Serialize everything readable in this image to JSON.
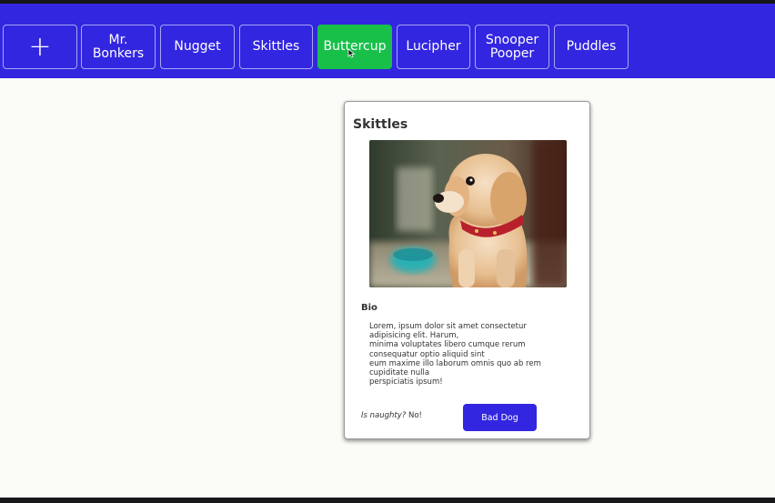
{
  "navbar": {
    "add_label": "+",
    "pets": [
      {
        "name": "Mr.\nBonkers",
        "active": false
      },
      {
        "name": "Nugget",
        "active": false
      },
      {
        "name": "Skittles",
        "active": false
      },
      {
        "name": "Buttercup",
        "active": true
      },
      {
        "name": "Lucipher",
        "active": false
      },
      {
        "name": "Snooper\nPooper",
        "active": false
      },
      {
        "name": "Puddles",
        "active": false
      }
    ]
  },
  "card": {
    "title": "Skittles",
    "photo_subject": "golden retriever puppy with red collar",
    "bio_heading": "Bio",
    "bio_text": "Lorem, ipsum dolor sit amet consectetur\nadipisicing elit. Harum,\nminima voluptates libero cumque rerum\nconsequatur optio aliquid sint\neum maxime illo laborum omnis quo ab rem\ncupiditate nulla\nperspiciatis ipsum!",
    "naughty_label": "Is naughty?",
    "naughty_value": "No!",
    "action_label": "Bad Dog"
  },
  "colors": {
    "navbar": "#3326e0",
    "active_tab": "#18c04a",
    "button": "#3326e0",
    "background": "#fbfcf8"
  }
}
